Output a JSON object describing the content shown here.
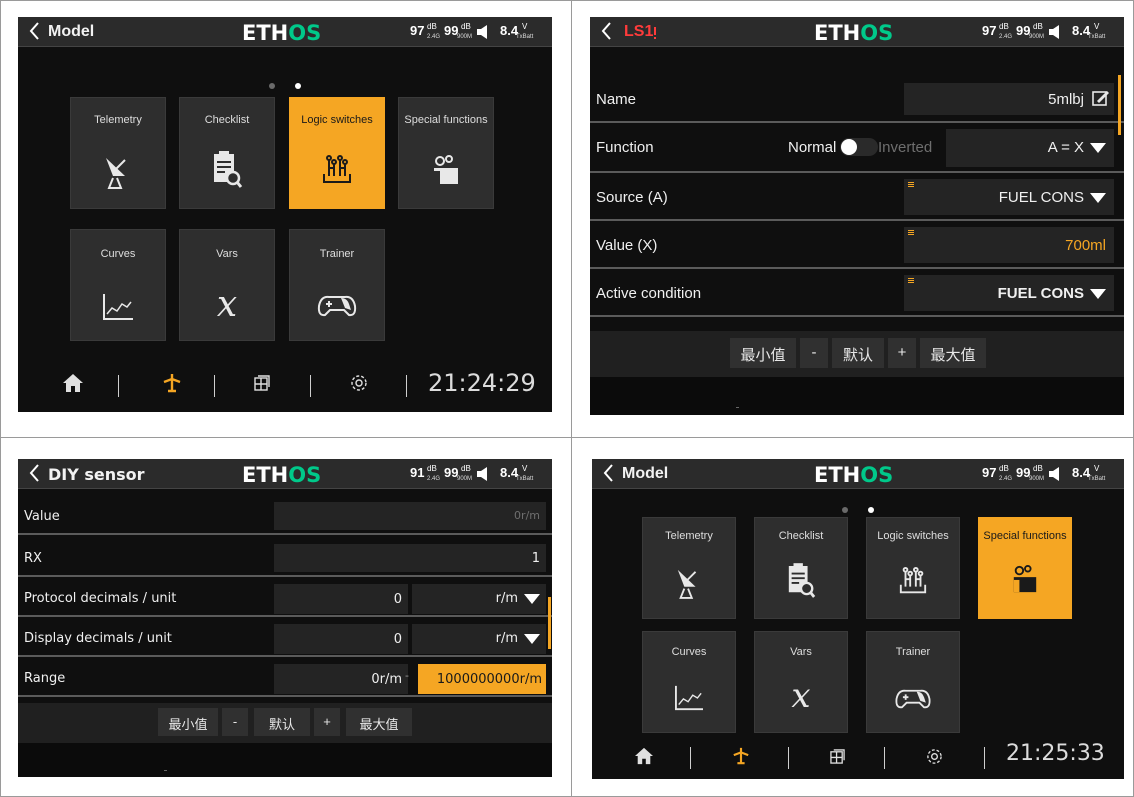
{
  "status": {
    "rssi24": "97",
    "rssi900": "99",
    "rssi24b": "91",
    "db": "dB",
    "band24": "2.4G",
    "band900": "900M",
    "volt": "8.4",
    "vunit": "V",
    "batt": "TxBatt"
  },
  "logo": {
    "white": "ETH",
    "green": "OS"
  },
  "screen1": {
    "title": "Model",
    "tiles_row1": [
      "Telemetry",
      "Checklist",
      "Logic switches",
      "Special functions"
    ],
    "tiles_row2": [
      "Curves",
      "Vars",
      "Trainer"
    ],
    "selected": "Logic switches",
    "clock": "21:24:29"
  },
  "screen2": {
    "title": "LS1",
    "rows": [
      {
        "label": "Name",
        "value": "5mlbj"
      },
      {
        "label": "Function",
        "toggle_left": "Normal",
        "toggle_right": "Inverted",
        "value": "A = X"
      },
      {
        "label": "Source (A)",
        "value": "FUEL CONS"
      },
      {
        "label": "Value (X)",
        "value": "700ml"
      },
      {
        "label": "Active condition",
        "value": "FUEL CONS"
      }
    ],
    "buttons": [
      "最小值",
      "-",
      "默认",
      "+",
      "最大值"
    ]
  },
  "screen3": {
    "title": "DIY sensor",
    "rows": [
      {
        "label": "Value",
        "value": "0r/m"
      },
      {
        "label": "RX",
        "value": "1"
      },
      {
        "label": "Protocol decimals / unit",
        "value": "0",
        "unit": "r/m"
      },
      {
        "label": "Display decimals / unit",
        "value": "0",
        "unit": "r/m"
      },
      {
        "label": "Range",
        "min": "0r/m",
        "dash": "-",
        "max": "1000000000r/m"
      }
    ],
    "buttons": [
      "最小值",
      "-",
      "默认",
      "+",
      "最大值"
    ]
  },
  "screen4": {
    "title": "Model",
    "tiles_row1": [
      "Telemetry",
      "Checklist",
      "Logic switches",
      "Special functions"
    ],
    "tiles_row2": [
      "Curves",
      "Vars",
      "Trainer"
    ],
    "selected": "Special functions",
    "clock": "21:25:33"
  },
  "colors": {
    "accent": "#f5a623",
    "logo_green": "#00c98a",
    "background": "#0f0f0f",
    "tile": "#2e2e2e",
    "title_red": "#ff3b3b"
  }
}
